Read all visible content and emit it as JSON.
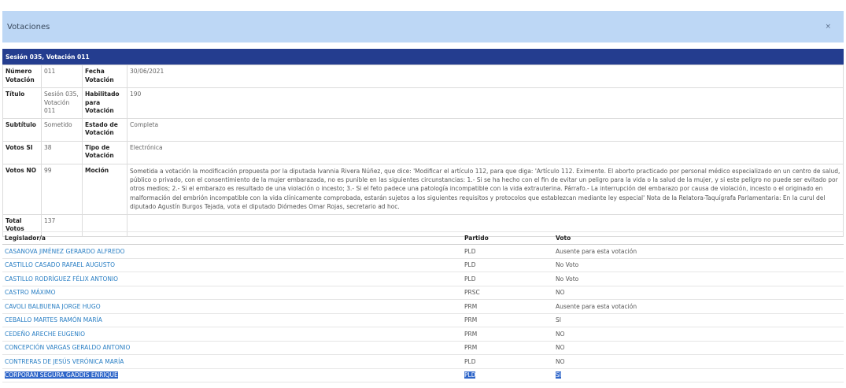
{
  "modal": {
    "title": "Votaciones",
    "close_label": "×"
  },
  "session": {
    "heading": "Sesión 035, Votación 011"
  },
  "info": {
    "numero_label": "Número Votación",
    "numero": "011",
    "fecha_label": "Fecha Votación",
    "fecha": "30/06/2021",
    "titulo_label": "Título",
    "titulo": "Sesión 035, Votación 011",
    "habilitado_label": "Habilitado para Votación",
    "habilitado": "190",
    "subtitulo_label": "Subtítulo",
    "subtitulo": "Sometido",
    "estado_label": "Estado de Votación",
    "estado": "Completa",
    "votos_si_label": "Votos SI",
    "votos_si": "38",
    "tipo_label": "Tipo de Votación",
    "tipo": "Electrónica",
    "votos_no_label": "Votos NO",
    "votos_no": "99",
    "mocion_label": "Moción",
    "mocion": "Sometida a votación la modificación propuesta por la diputada Ivannia Rivera Núñez, que dice: 'Modificar el artículo 112, para que diga: 'Artículo 112. Eximente. El aborto practicado por personal médico especializado en un centro de salud, público o privado, con el consentimiento de la mujer embarazada, no es punible en las siguientes circunstancias: 1.- Si se ha hecho con el fin de evitar un peligro para la vida o la salud de la mujer, y si este peligro no puede ser evitado por otros medios; 2.- Si el embarazo es resultado de una violación o incesto; 3.- Si el feto padece una patología incompatible con la vida extrauterina. Párrafo.- La interrupción del embarazo por causa de violación, incesto o el originado en malformación del embrión incompatible con la vida clínicamente comprobada, estarán sujetos a los siguientes requisitos y protocolos que establezcan mediante ley especial' Nota de la Relatora-Taquígrafa Parlamentaria: En la curul del diputado Agustín Burgos Tejada, vota el diputado Diómedes Omar Rojas, secretario ad hoc.",
    "total_label": "Total Votos",
    "total": "137"
  },
  "legislators": {
    "headers": {
      "name": "Legislador/a",
      "party": "Partido",
      "vote": "Voto"
    },
    "rows": [
      {
        "name": "CASANOVA JIMÉNEZ GERARDO ALFREDO",
        "party": "PLD",
        "vote": "Ausente para esta votación"
      },
      {
        "name": "CASTILLO CASADO RAFAEL AUGUSTO",
        "party": "PLD",
        "vote": "No Voto"
      },
      {
        "name": "CASTILLO RODRÍGUEZ FÉLIX ANTONIO",
        "party": "PLD",
        "vote": "No Voto"
      },
      {
        "name": "CASTRO MÁXIMO",
        "party": "PRSC",
        "vote": "NO"
      },
      {
        "name": "CAVOLI BALBUENA JORGE HUGO",
        "party": "PRM",
        "vote": "Ausente para esta votación"
      },
      {
        "name": "CEBALLO MARTES RAMÓN MARÍA",
        "party": "PRM",
        "vote": "SI"
      },
      {
        "name": "CEDEÑO ARECHE EUGENIO",
        "party": "PRM",
        "vote": "NO"
      },
      {
        "name": "CONCEPCIÓN VARGAS GERALDO ANTONIO",
        "party": "PRM",
        "vote": "NO"
      },
      {
        "name": "CONTRERAS DE JESÚS VERÓNICA MARÍA",
        "party": "PLD",
        "vote": "NO"
      },
      {
        "name": "CORPORÁN SEGURA GADDIS ENRIQUE",
        "party": "PLD",
        "vote": "SI"
      }
    ]
  }
}
